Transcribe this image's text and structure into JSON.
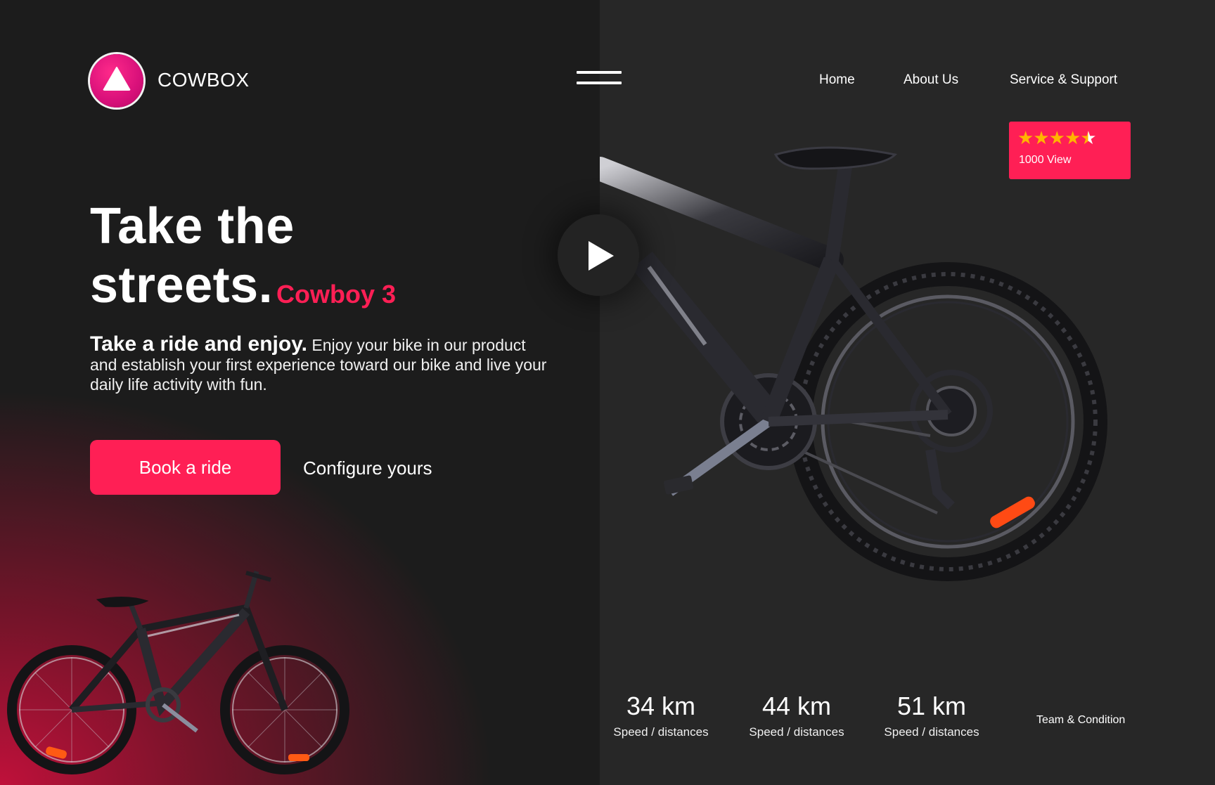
{
  "brand": {
    "name": "COWBOX",
    "logo_icon": "triangle-icon"
  },
  "nav": {
    "items": [
      "Home",
      "About Us",
      "Service & Support"
    ],
    "menu_icon": "hamburger-icon"
  },
  "hero": {
    "title_line1": "Take the",
    "title_line2": "streets.",
    "model": "Cowboy 3",
    "lead": "Take a ride and enjoy.",
    "description": " Enjoy your bike in our product and establish your first experience toward our bike and live your daily life activity with fun.",
    "primary_button": "Book a ride",
    "secondary_link": "Configure yours"
  },
  "rating": {
    "stars": 4.5,
    "views": "1000 View"
  },
  "stats": [
    {
      "value": "34 km",
      "label": "Speed / distances"
    },
    {
      "value": "44 km",
      "label": "Speed / distances"
    },
    {
      "value": "51 km",
      "label": "Speed / distances"
    }
  ],
  "footer_link": "Team & Condition",
  "colors": {
    "accent": "#ff1f55",
    "dark_left": "#1c1c1c",
    "dark_right": "#272727",
    "star": "#ffb400"
  }
}
